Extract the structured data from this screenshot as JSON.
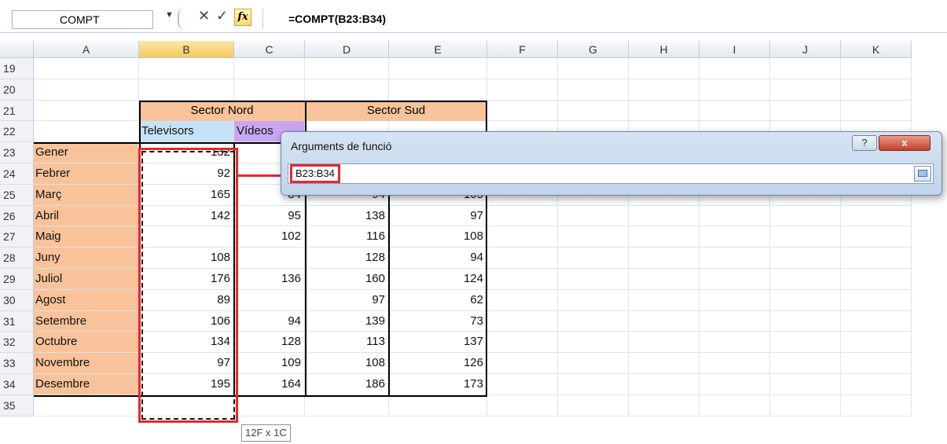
{
  "formula_bar": {
    "name_box": "COMPT",
    "dropdown_glyph": "▼",
    "cancel_glyph": "✕",
    "enter_glyph": "✓",
    "fx_label": "fx",
    "formula": "=COMPT(B23:B34)"
  },
  "columns": [
    "A",
    "B",
    "C",
    "D",
    "E",
    "F",
    "G",
    "H",
    "I",
    "J",
    "K"
  ],
  "rows": [
    "19",
    "20",
    "21",
    "22",
    "23",
    "24",
    "25",
    "26",
    "27",
    "28",
    "29",
    "30",
    "31",
    "32",
    "33",
    "34",
    "35"
  ],
  "headers": {
    "sector_nord": "Sector Nord",
    "sector_sud": "Sector Sud",
    "televisors": "Televisors",
    "videos": "Vídeos"
  },
  "months": [
    "Gener",
    "Febrer",
    "Març",
    "Abril",
    "Maig",
    "Juny",
    "Juliol",
    "Agost",
    "Setembre",
    "Octubre",
    "Novembre",
    "Desembre"
  ],
  "values_b": [
    "132",
    "92",
    "165",
    "142",
    "",
    "108",
    "176",
    "89",
    "106",
    "134",
    "97",
    "195"
  ],
  "values_c": [
    "",
    "",
    "84",
    "95",
    "102",
    "",
    "136",
    "",
    "94",
    "128",
    "109",
    "164"
  ],
  "values_d": [
    "",
    "",
    "94",
    "138",
    "116",
    "128",
    "160",
    "97",
    "139",
    "113",
    "108",
    "186"
  ],
  "values_e": [
    "",
    "",
    "105",
    "97",
    "108",
    "94",
    "124",
    "62",
    "73",
    "137",
    "126",
    "173"
  ],
  "dialog": {
    "title": "Arguments de funció",
    "help": "?",
    "close": "x",
    "input_value": "B23:B34"
  },
  "tooltip": "12F x 1C",
  "colors": {
    "month_fill": "#f8c39a",
    "televisors_fill": "#c5e3f7",
    "videos_fill": "#c9a6f2",
    "highlight_red": "#e8262e"
  }
}
